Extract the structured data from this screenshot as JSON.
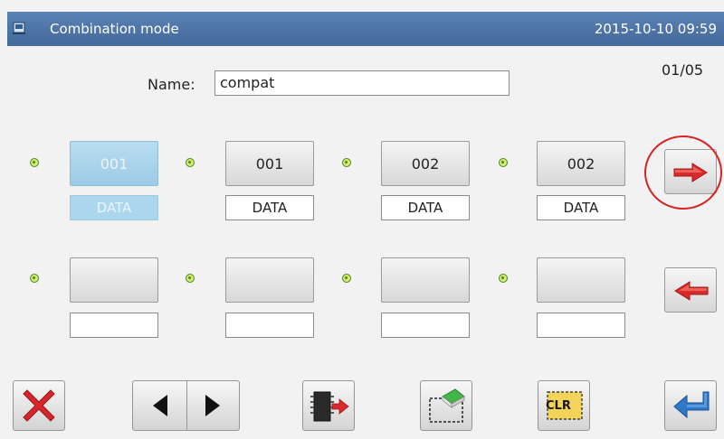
{
  "header": {
    "title": "Combination mode",
    "datetime": "2015-10-10 09:59"
  },
  "form": {
    "name_label": "Name:",
    "name_value": "compat"
  },
  "page_indicator": "01/05",
  "slots": [
    {
      "code": "001",
      "data_label": "DATA",
      "selected": true
    },
    {
      "code": "001",
      "data_label": "DATA",
      "selected": false
    },
    {
      "code": "002",
      "data_label": "DATA",
      "selected": false
    },
    {
      "code": "002",
      "data_label": "DATA",
      "selected": false
    },
    {
      "code": "",
      "data_label": "",
      "selected": false
    },
    {
      "code": "",
      "data_label": "",
      "selected": false
    },
    {
      "code": "",
      "data_label": "",
      "selected": false
    },
    {
      "code": "",
      "data_label": "",
      "selected": false
    }
  ],
  "toolbar": {
    "clear_label": "CLR"
  },
  "icons": {
    "header": "panel-icon",
    "slot_marker": "green-dot-icon",
    "next_page": "red-arrow-right-icon",
    "prev_page": "red-arrow-left-icon",
    "cancel": "red-x-icon",
    "cursor_left": "triangle-left-icon",
    "cursor_right": "triangle-right-icon",
    "write": "chip-arrow-icon",
    "erase": "eraser-icon",
    "clear": "clr-icon",
    "enter": "return-arrow-icon"
  },
  "colors": {
    "header_bg": "#4f77aa",
    "selected_slot": "#a8d4ec",
    "arrow_red": "#d9292a",
    "enter_blue": "#2f79c8",
    "dot_green": "#3f8a2e"
  }
}
